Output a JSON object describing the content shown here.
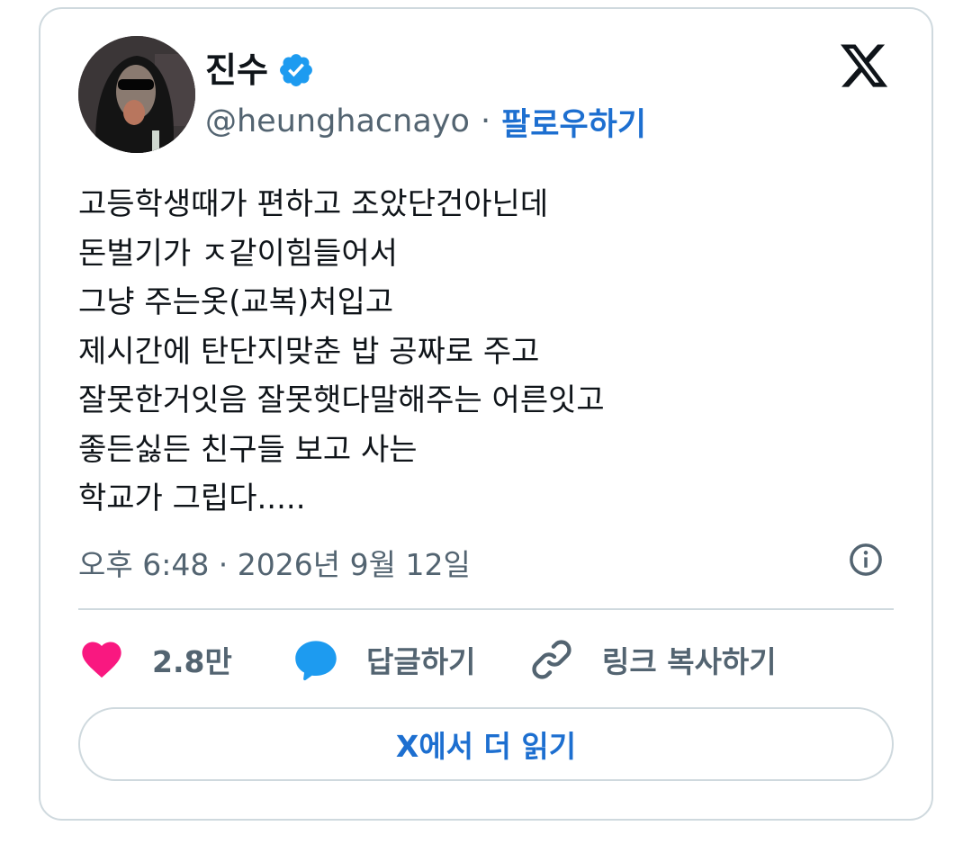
{
  "author": {
    "display_name": "진수",
    "handle": "@heunghacnayo",
    "separator": "·",
    "follow_label": "팔로우하기"
  },
  "tweet": {
    "lines": [
      "고등학생때가 편하고 조았단건아닌데",
      "돈벌기가 ㅈ같이힘들어서",
      "그냥 주는옷(교복)처입고",
      "제시간에 탄단지맞춘 밥 공짜로 주고",
      "잘못한거잇음 잘못햇다말해주는 어른잇고",
      "좋든싫든 친구들 보고 사는",
      "학교가 그립다....."
    ],
    "timestamp": "오후 6:48 · 2026년 9월 12일"
  },
  "actions": {
    "like_count": "2.8만",
    "reply_label": "답글하기",
    "copy_link_label": "링크 복사하기"
  },
  "read_more_label": "X에서 더 읽기",
  "icons": {
    "verified": "verified-badge-icon",
    "logo": "x-logo-icon",
    "info": "info-icon",
    "like": "heart-icon",
    "reply": "speech-bubble-icon",
    "link": "link-icon"
  },
  "colors": {
    "accent_blue": "#1d6fd0",
    "verified_blue": "#1d9bf0",
    "heart": "#f91880",
    "secondary_text": "#536471",
    "border": "#cfd9de"
  }
}
